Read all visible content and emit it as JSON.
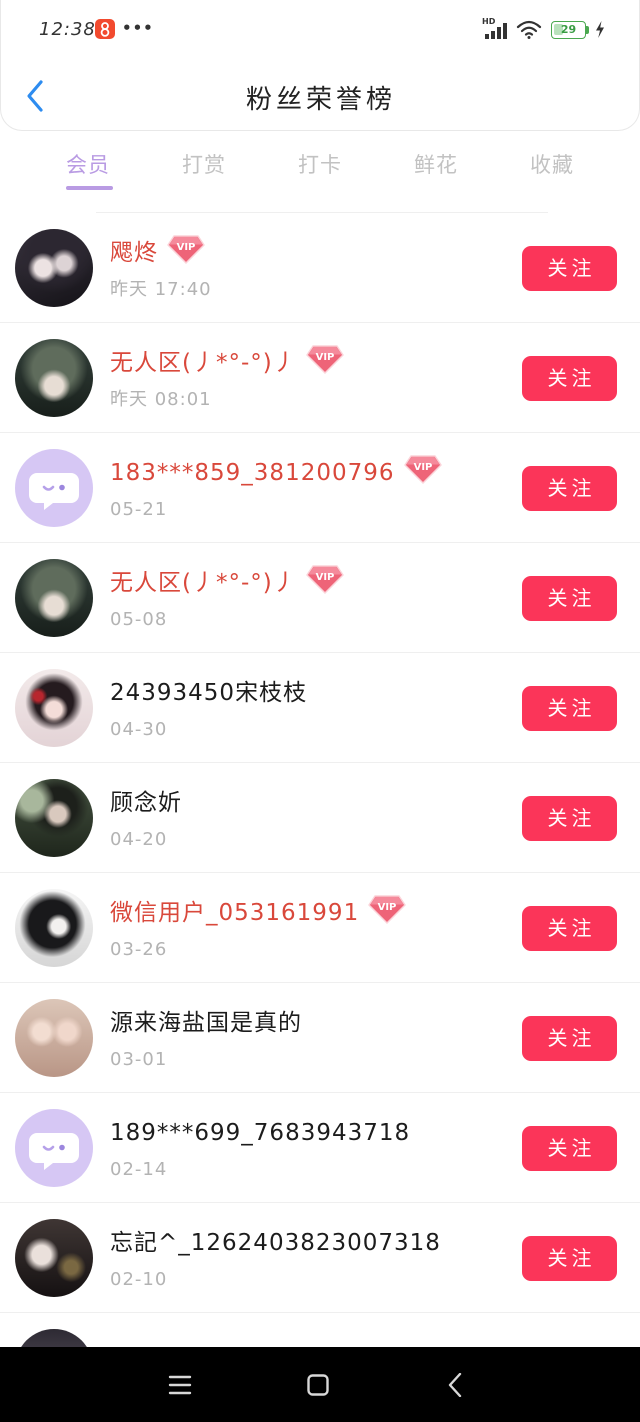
{
  "status_bar": {
    "time": "12:38",
    "more_dots": "•••",
    "network_label": "HD",
    "battery_level": "29",
    "icons": [
      "app-notification-icon",
      "signal-icon",
      "wifi-icon",
      "battery-icon",
      "charging-icon"
    ]
  },
  "header": {
    "title": "粉丝荣誉榜",
    "back_icon": "back-chevron-icon"
  },
  "tabs": [
    {
      "label": "会员",
      "active": true
    },
    {
      "label": "打赏",
      "active": false
    },
    {
      "label": "打卡",
      "active": false
    },
    {
      "label": "鲜花",
      "active": false
    },
    {
      "label": "收藏",
      "active": false
    }
  ],
  "fan_list": {
    "follow_label": "关注",
    "vip_badge_label": "VIP",
    "items": [
      {
        "name": "飔炵",
        "time": "昨天 17:40",
        "vip": true,
        "avatar": "photo"
      },
      {
        "name": "无人区(丿*°-°)丿",
        "time": "昨天 08:01",
        "vip": true,
        "avatar": "photo"
      },
      {
        "name": "183***859_381200796",
        "time": "05-21",
        "vip": true,
        "avatar": "default"
      },
      {
        "name": "无人区(丿*°-°)丿",
        "time": "05-08",
        "vip": true,
        "avatar": "photo"
      },
      {
        "name": "24393450宋枝枝",
        "time": "04-30",
        "vip": false,
        "avatar": "photo"
      },
      {
        "name": "顾念妡",
        "time": "04-20",
        "vip": false,
        "avatar": "photo"
      },
      {
        "name": "微信用户_053161991",
        "time": "03-26",
        "vip": true,
        "avatar": "photo"
      },
      {
        "name": "源来海盐国是真的",
        "time": "03-01",
        "vip": false,
        "avatar": "photo"
      },
      {
        "name": "189***699_7683943718",
        "time": "02-14",
        "vip": false,
        "avatar": "default"
      },
      {
        "name": "忘記^_1262403823007318",
        "time": "02-10",
        "vip": false,
        "avatar": "photo"
      }
    ]
  },
  "nav_bar": {
    "icons": [
      "menu-icon",
      "home-icon",
      "back-icon"
    ]
  },
  "colors": {
    "accent_tab": "#b99be3",
    "follow_button": "#fb3559",
    "vip_name": "#d9483b",
    "back_arrow": "#2d8cf0"
  }
}
